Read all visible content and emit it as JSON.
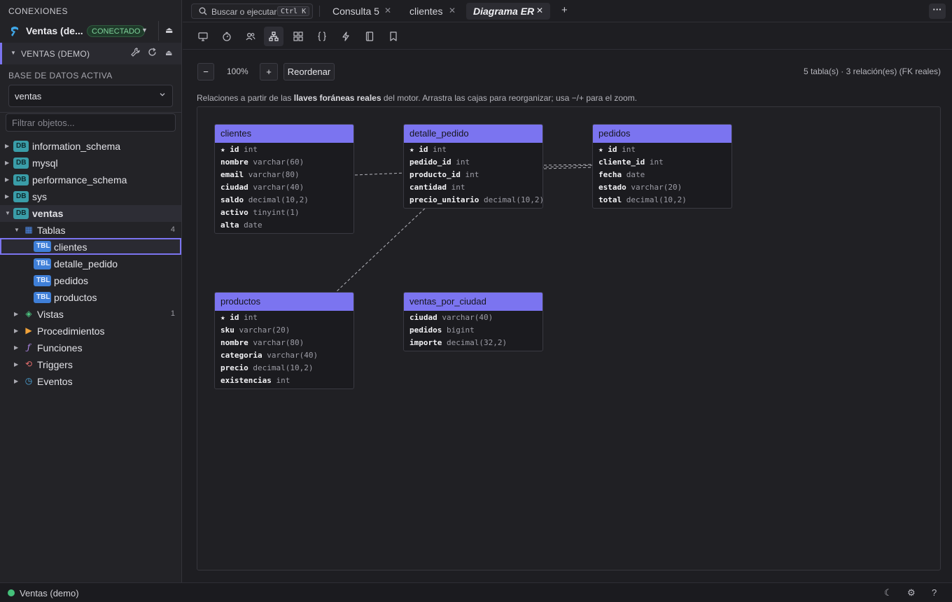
{
  "sidebar": {
    "section_title": "CONEXIONES",
    "connection": {
      "name": "Ventas (de...",
      "status": "CONECTADO"
    },
    "db_header": "VENTAS (DEMO)",
    "active_db_label": "BASE DE DATOS ACTIVA",
    "active_db_value": "ventas",
    "filter_placeholder": "Filtrar objetos...",
    "databases": [
      {
        "badge": "DB",
        "name": "information_schema"
      },
      {
        "badge": "DB",
        "name": "mysql"
      },
      {
        "badge": "DB",
        "name": "performance_schema"
      },
      {
        "badge": "DB",
        "name": "sys"
      },
      {
        "badge": "DB",
        "name": "ventas"
      }
    ],
    "tables_group": {
      "label": "Tablas",
      "count": "4"
    },
    "tables": [
      {
        "badge": "TBL",
        "name": "clientes"
      },
      {
        "badge": "TBL",
        "name": "detalle_pedido"
      },
      {
        "badge": "TBL",
        "name": "pedidos"
      },
      {
        "badge": "TBL",
        "name": "productos"
      }
    ],
    "groups": [
      {
        "label": "Vistas",
        "count": "1",
        "icon": "view-icon",
        "color": "#4cc17f"
      },
      {
        "label": "Procedimientos",
        "icon": "play-icon",
        "color": "#f0a23a"
      },
      {
        "label": "Funciones",
        "icon": "function-icon",
        "color": "#b58cf0"
      },
      {
        "label": "Triggers",
        "icon": "trigger-icon",
        "color": "#e06c6c"
      },
      {
        "label": "Eventos",
        "icon": "clock-icon",
        "color": "#4fb0e8"
      }
    ]
  },
  "tabs": {
    "search_placeholder": "Buscar o ejecutar",
    "search_shortcut": "Ctrl K",
    "items": [
      {
        "label": "Consulta 5"
      },
      {
        "label": "clientes"
      },
      {
        "label": "Diagrama ER"
      }
    ],
    "add": "+",
    "menu": "···"
  },
  "toolbar": {
    "icons": [
      "monitor-icon",
      "timer-icon",
      "users-icon",
      "diagram-icon",
      "grid-icon",
      "braces-icon",
      "bolt-icon",
      "notebook-icon",
      "bookmark-icon"
    ],
    "active_icon": "diagram-icon"
  },
  "diagram": {
    "zoom_out": "−",
    "zoom": "100%",
    "zoom_in": "+",
    "reorder": "Reordenar",
    "summary": "5 tabla(s) · 3 relación(es) (FK reales)",
    "info_prefix": "Relaciones a partir de las ",
    "info_bold": "llaves foráneas reales",
    "info_suffix": " del motor. Arrastra las cajas para reorganizar; usa −/+ para el zoom.",
    "tables": [
      {
        "name": "clientes",
        "columns": [
          {
            "pk": true,
            "name": "id",
            "type": "int"
          },
          {
            "name": "nombre",
            "type": "varchar(60)"
          },
          {
            "name": "email",
            "type": "varchar(80)"
          },
          {
            "name": "ciudad",
            "type": "varchar(40)"
          },
          {
            "name": "saldo",
            "type": "decimal(10,2)"
          },
          {
            "name": "activo",
            "type": "tinyint(1)"
          },
          {
            "name": "alta",
            "type": "date"
          }
        ]
      },
      {
        "name": "detalle_pedido",
        "columns": [
          {
            "pk": true,
            "name": "id",
            "type": "int"
          },
          {
            "name": "pedido_id",
            "type": "int"
          },
          {
            "name": "producto_id",
            "type": "int"
          },
          {
            "name": "cantidad",
            "type": "int"
          },
          {
            "name": "precio_unitario",
            "type": "decimal(10,2)"
          }
        ]
      },
      {
        "name": "pedidos",
        "columns": [
          {
            "pk": true,
            "name": "id",
            "type": "int"
          },
          {
            "name": "cliente_id",
            "type": "int"
          },
          {
            "name": "fecha",
            "type": "date"
          },
          {
            "name": "estado",
            "type": "varchar(20)"
          },
          {
            "name": "total",
            "type": "decimal(10,2)"
          }
        ]
      },
      {
        "name": "productos",
        "columns": [
          {
            "pk": true,
            "name": "id",
            "type": "int"
          },
          {
            "name": "sku",
            "type": "varchar(20)"
          },
          {
            "name": "nombre",
            "type": "varchar(80)"
          },
          {
            "name": "categoria",
            "type": "varchar(40)"
          },
          {
            "name": "precio",
            "type": "decimal(10,2)"
          },
          {
            "name": "existencias",
            "type": "int"
          }
        ]
      },
      {
        "name": "ventas_por_ciudad",
        "columns": [
          {
            "name": "ciudad",
            "type": "varchar(40)"
          },
          {
            "name": "pedidos",
            "type": "bigint"
          },
          {
            "name": "importe",
            "type": "decimal(32,2)"
          }
        ]
      }
    ]
  },
  "status": {
    "connection": "Ventas (demo)",
    "icons": [
      "moon-icon",
      "gear-icon",
      "help-icon"
    ]
  },
  "colors": {
    "accent": "#7b74f0",
    "connected": "#44c07a",
    "db_badge": "#3a9da8",
    "tbl_badge": "#3f7fd8"
  }
}
